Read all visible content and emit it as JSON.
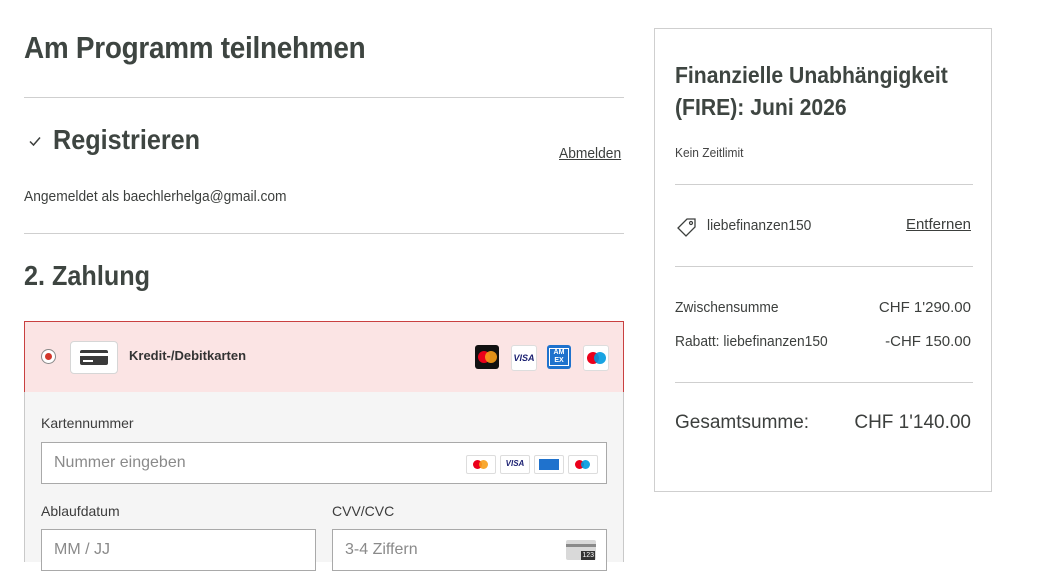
{
  "page": {
    "title": "Am Programm teilnehmen"
  },
  "step1": {
    "title": "Registrieren",
    "logout_label": "Abmelden",
    "logged_in_text": "Angemeldet als baechlerhelga@gmail.com"
  },
  "step2": {
    "title": "2. Zahlung",
    "payment_option": {
      "label": "Kredit-/Debitkarten",
      "selected": true,
      "brands": [
        "mastercard-icon",
        "visa-icon",
        "amex-icon",
        "maestro-icon"
      ]
    },
    "card_form": {
      "number_label": "Kartennummer",
      "number_placeholder": "Nummer eingeben",
      "expiry_label": "Ablaufdatum",
      "expiry_placeholder": "MM / JJ",
      "cvv_label": "CVV/CVC",
      "cvv_placeholder": "3-4 Ziffern",
      "cvv_icon_text": "123"
    }
  },
  "summary": {
    "course_title": "Finanzielle Unabhängigkeit (FIRE): Juni 2026",
    "time_limit": "Kein Zeitlimit",
    "coupon_code": "liebefinanzen150",
    "remove_label": "Entfernen",
    "subtotal_label": "Zwischensumme",
    "subtotal_value": "CHF 1'290.00",
    "discount_label": "Rabatt: liebefinanzen150",
    "discount_value": "-CHF 150.00",
    "total_label": "Gesamtsumme:",
    "total_value": "CHF 1'140.00"
  },
  "colors": {
    "accent_red": "#d2372c",
    "selected_bg": "#fbe4e4",
    "text": "#3c3f3d"
  }
}
